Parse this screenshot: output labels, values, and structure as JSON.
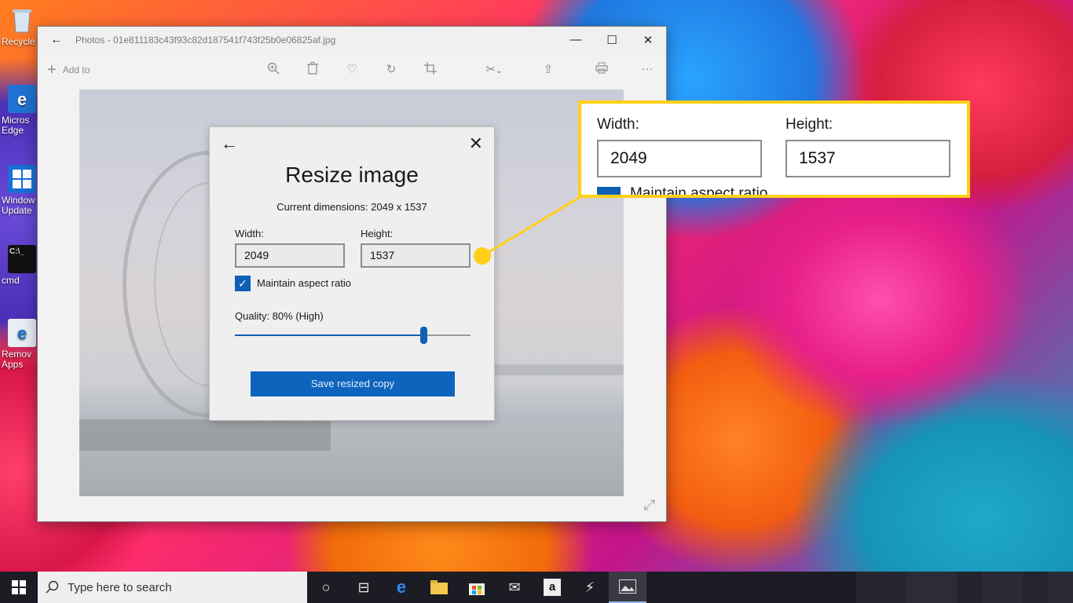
{
  "desktop": {
    "icons": [
      {
        "label": "Recycle",
        "icon": "recycle-bin-icon"
      },
      {
        "label": "Micros\nEdge",
        "icon": "edge-icon"
      },
      {
        "label": "Window\nUpdate",
        "icon": "windows-update-icon"
      },
      {
        "label": "cmd",
        "icon": "cmd-icon"
      },
      {
        "label": "Remov\nApps",
        "icon": "remove-apps-icon"
      }
    ]
  },
  "window": {
    "title": "Photos - 01e811183c43f93c82d187541f743f25b0e06825af.jpg",
    "controls": {
      "minimize": "—",
      "maximize": "☐",
      "close": "✕"
    },
    "toolbar": {
      "add_to": "Add to"
    }
  },
  "dialog": {
    "title": "Resize image",
    "current_dimensions": "Current dimensions: 2049 x 1537",
    "width_label": "Width:",
    "width_value": "2049",
    "height_label": "Height:",
    "height_value": "1537",
    "maintain_aspect_label": "Maintain aspect ratio",
    "maintain_aspect_checked": true,
    "quality_label": "Quality: 80% (High)",
    "quality_value": 80,
    "save_button": "Save resized copy"
  },
  "callout": {
    "width_label": "Width:",
    "width_value": "2049",
    "height_label": "Height:",
    "height_value": "1537",
    "partial_text": "Maintain aspect ratio",
    "accent_color": "#ffd017"
  },
  "taskbar": {
    "search_placeholder": "Type here to search",
    "icons": [
      "cortana-icon",
      "task-view-icon",
      "edge-icon",
      "file-explorer-icon",
      "store-icon",
      "mail-icon",
      "amazon-icon",
      "app-icon",
      "photos-icon"
    ]
  },
  "colors": {
    "accent": "#0e64bd",
    "callout": "#ffd017"
  }
}
